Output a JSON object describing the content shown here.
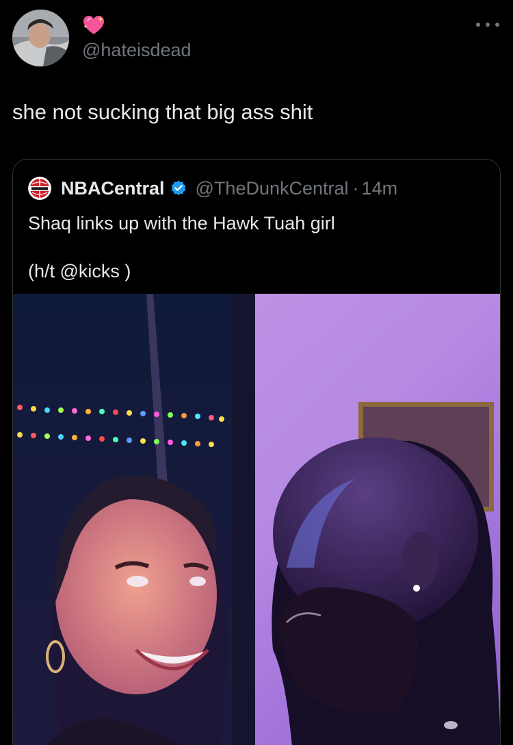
{
  "tweet": {
    "handle": "@hateisdead",
    "name_icon": "sparkling-heart-icon",
    "avatar_icon": "avatar",
    "more_icon": "more-options-icon",
    "text": "she not sucking that big ass shit"
  },
  "quote": {
    "name": "NBACentral",
    "logo_icon": "nba-central-logo",
    "verified_icon": "verified-badge-icon",
    "handle": "@TheDunkCentral",
    "separator": "·",
    "time": "14m",
    "text_line1": "Shaq links up with the Hawk Tuah girl",
    "text_line2": "(h/t @kicks )",
    "photo": "photo of a smiling woman and a bald bearded man looking at each other in purple lighting"
  },
  "colors": {
    "background": "#000000",
    "text_primary": "#e7e9ea",
    "text_secondary": "#71767b",
    "border": "#333639",
    "verified": "#1d9bf0"
  }
}
